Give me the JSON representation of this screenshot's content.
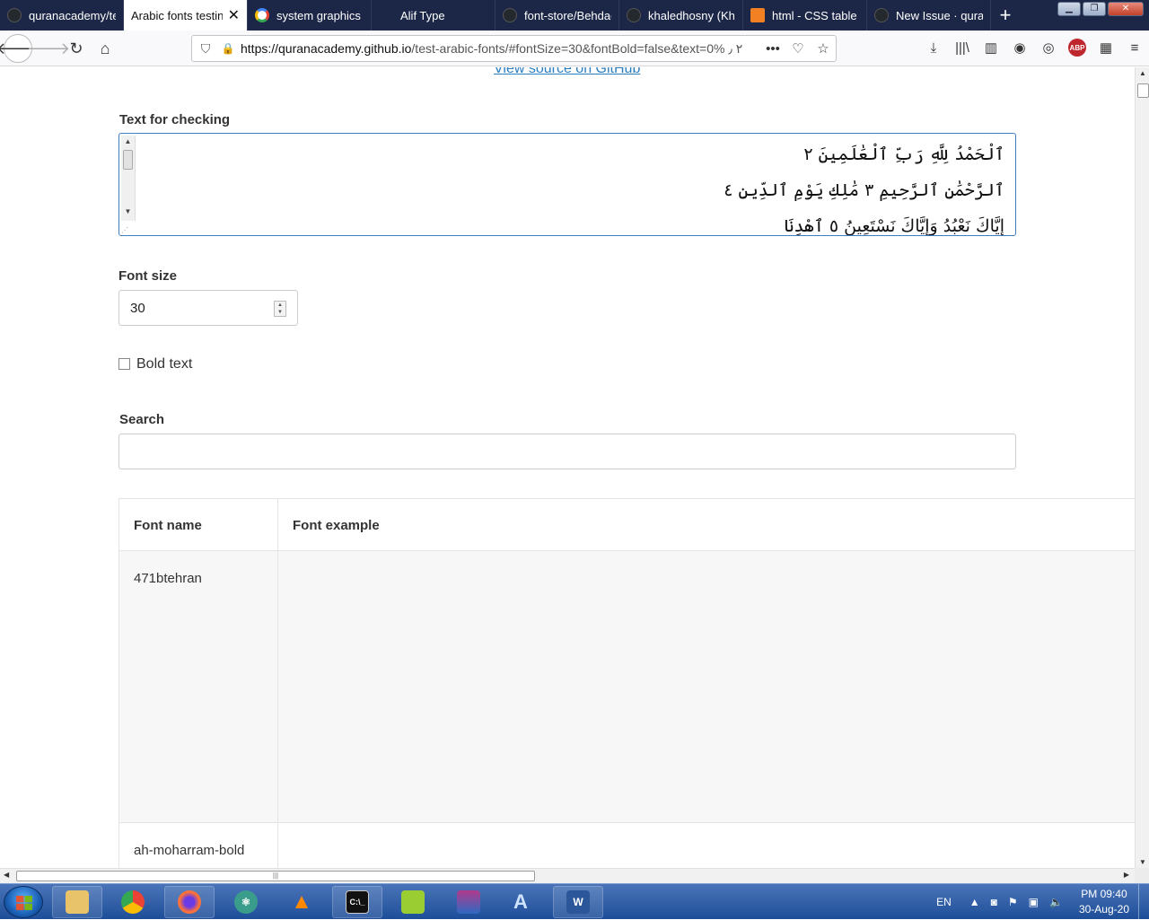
{
  "browser": {
    "tabs": [
      {
        "label": "quranacademy/te",
        "color": "#24292e"
      },
      {
        "label": "Arabic fonts testing",
        "color": "#ffffff",
        "active": true
      },
      {
        "label": "system graphics A",
        "color": "#4285f4"
      },
      {
        "label": "Alif Type",
        "color": "#1c2747"
      },
      {
        "label": "font-store/Behdad",
        "color": "#24292e"
      },
      {
        "label": "khaledhosny (Kha",
        "color": "#24292e"
      },
      {
        "label": "html - CSS table c",
        "color": "#f48024"
      },
      {
        "label": "New Issue · quran",
        "color": "#24292e"
      }
    ],
    "url_host": "https://quranacademy.github.io",
    "url_path": "/test-arabic-fonts/#fontSize=30&fontBold=false&text=0% ٢ ٫"
  },
  "page": {
    "github_link": "View source on GitHub",
    "text_label": "Text for checking",
    "text_lines": [
      "ٱلْحَمْدُ لِلَّهِ رَبِّ ٱلْعَٰلَمِينَ ٢",
      "ٱلرَّحْمَٰنِ ٱلرَّحِيمِ ٣ مَٰلِكِ يَوْمِ ٱلدِّينِ ٤",
      "إِيَّاكَ نَعْبُدُ وَإِيَّاكَ نَسْتَعِينُ ٥ ٱهْدِنَا"
    ],
    "font_size_label": "Font size",
    "font_size_value": "30",
    "bold_label": "Bold text",
    "search_label": "Search",
    "table": {
      "headers": [
        "Font name",
        "Font example"
      ],
      "rows": [
        {
          "name": "471btehran",
          "example": ""
        },
        {
          "name": "ah-moharram-bold",
          "example": ""
        }
      ]
    }
  },
  "taskbar": {
    "lang": "EN",
    "time": "PM 09:40",
    "date": "30-Aug-20"
  },
  "colors": {
    "tabbar": "#1c2747",
    "link": "#2a7ec2",
    "focus_border": "#3d7fc1"
  }
}
